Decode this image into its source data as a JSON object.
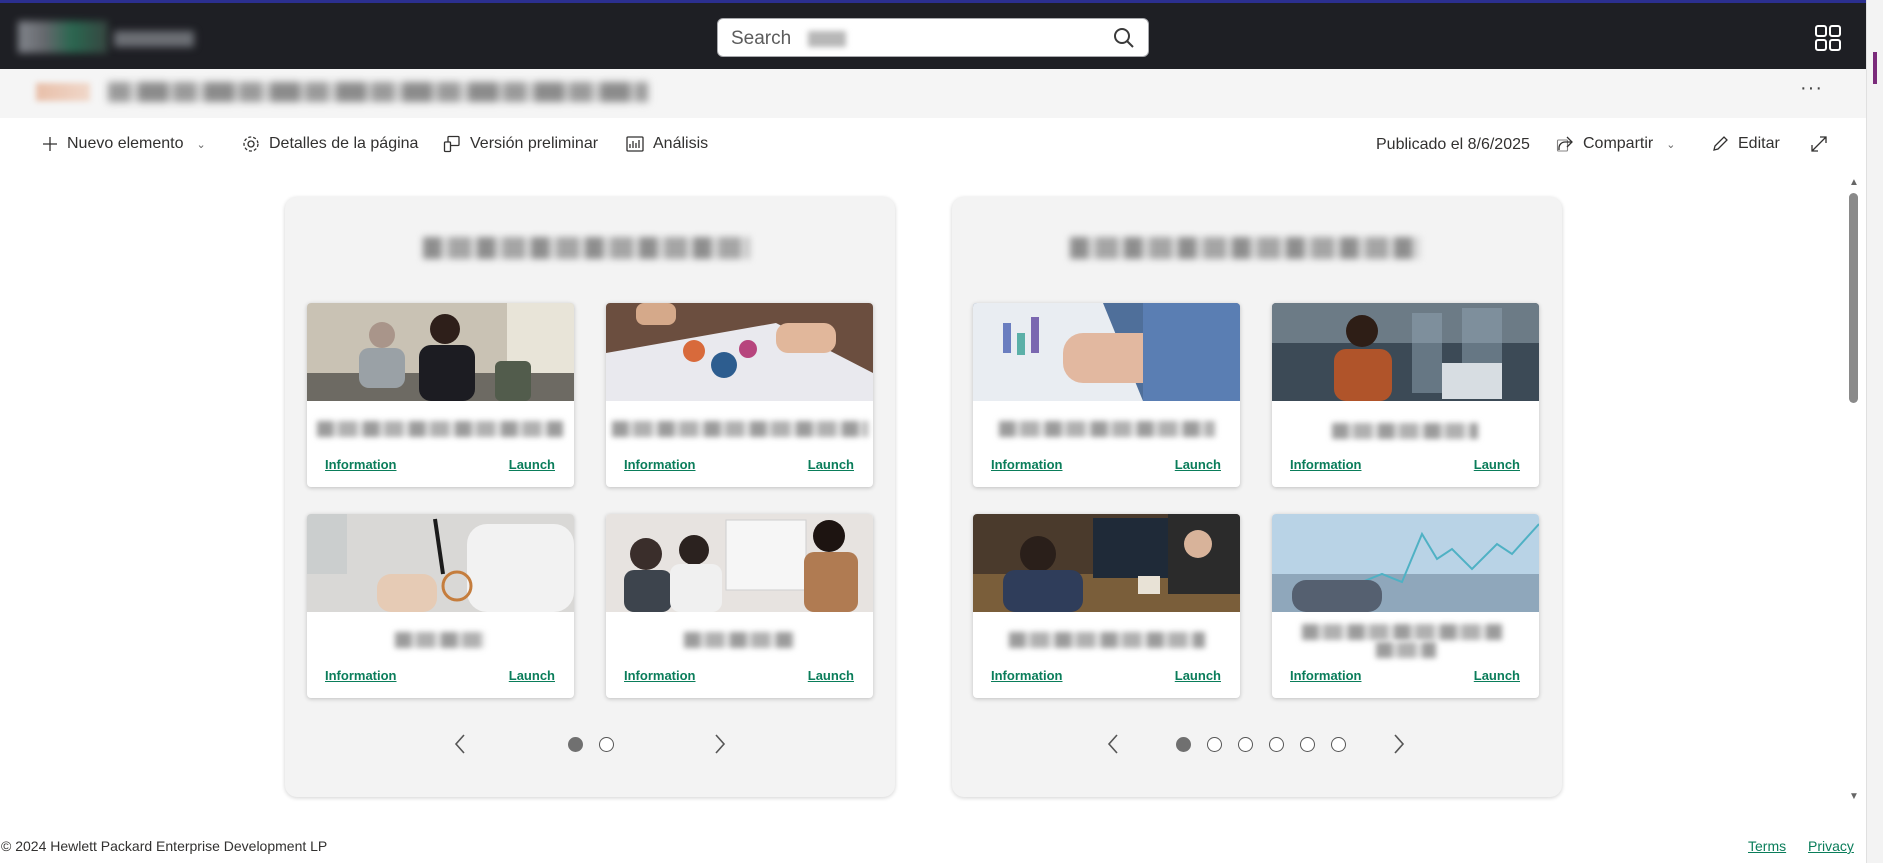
{
  "search": {
    "placeholder": "Search"
  },
  "commands": {
    "new_item": "Nuevo elemento",
    "page_details": "Detalles de la página",
    "preview": "Versión preliminar",
    "analytics": "Análisis",
    "published": "Publicado el 8/6/2025",
    "share": "Compartir",
    "edit": "Editar"
  },
  "panels": [
    {
      "cards": [
        {
          "info": "Information",
          "launch": "Launch"
        },
        {
          "info": "Information",
          "launch": "Launch"
        },
        {
          "info": "Information",
          "launch": "Launch"
        },
        {
          "info": "Information",
          "launch": "Launch"
        }
      ],
      "page_count": 2,
      "active_page": 1
    },
    {
      "cards": [
        {
          "info": "Information",
          "launch": "Launch"
        },
        {
          "info": "Information",
          "launch": "Launch"
        },
        {
          "info": "Information",
          "launch": "Launch"
        },
        {
          "info": "Information",
          "launch": "Launch"
        }
      ],
      "page_count": 6,
      "active_page": 1
    }
  ],
  "footer": {
    "copyright": "© 2024  Hewlett Packard Enterprise Development LP",
    "terms": "Terms",
    "privacy": "Privacy"
  },
  "colors": {
    "link": "#0a7d5a",
    "suitebar": "#1e1f24",
    "accent": "#2b2f8f"
  }
}
